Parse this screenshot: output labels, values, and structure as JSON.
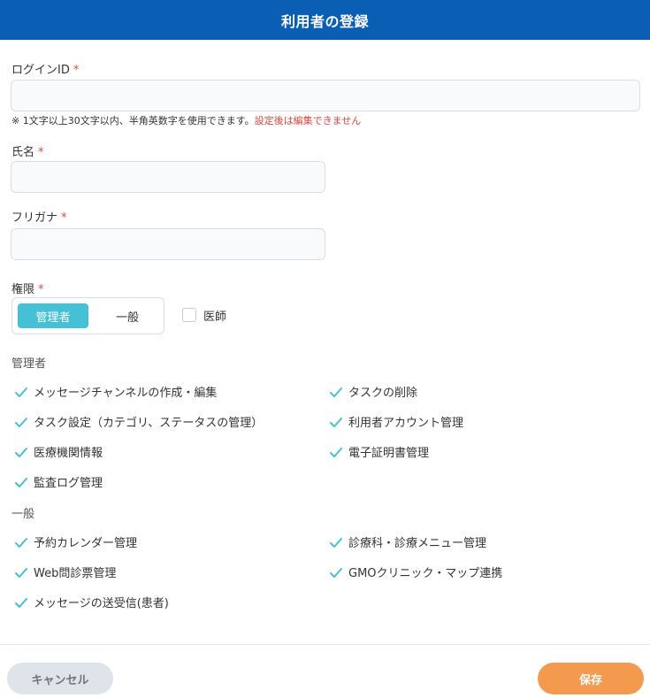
{
  "header": {
    "title": "利用者の登録"
  },
  "form": {
    "login_id": {
      "label": "ログインID",
      "required_mark": "*",
      "value": "",
      "placeholder": ""
    },
    "login_id_note": "※ 1文字以上30文字以内、半角英数字を使用できます。",
    "login_id_warning": "設定後は編集できません",
    "name": {
      "label": "氏名",
      "required_mark": "*",
      "value": "",
      "placeholder": ""
    },
    "furigana": {
      "label": "フリガナ",
      "required_mark": "*",
      "value": "",
      "placeholder": ""
    },
    "role": {
      "label": "権限",
      "required_mark": "*",
      "options": [
        "管理者",
        "一般"
      ],
      "selected": "管理者"
    },
    "doctor": {
      "label": "医師",
      "checked": false
    }
  },
  "permissions": {
    "admin": {
      "title": "管理者",
      "items": [
        "メッセージチャンネルの作成・編集",
        "タスクの削除",
        "タスク設定（カテゴリ、ステータスの管理）",
        "利用者アカウント管理",
        "医療機関情報",
        "電子証明書管理",
        "監査ログ管理"
      ]
    },
    "general": {
      "title": "一般",
      "items": [
        "予約カレンダー管理",
        "診療科・診療メニュー管理",
        "Web問診票管理",
        "GMOクリニック・マップ連携",
        "メッセージの送受信(患者)"
      ]
    }
  },
  "footer": {
    "cancel_label": "キャンセル",
    "save_label": "保存"
  },
  "colors": {
    "header_bg": "#0a5fb4",
    "accent": "#45c0d6",
    "required": "#e2453b",
    "save_button": "#f39a4e",
    "cancel_button": "#dfe4ea"
  },
  "icons": {
    "check": "check-icon"
  }
}
